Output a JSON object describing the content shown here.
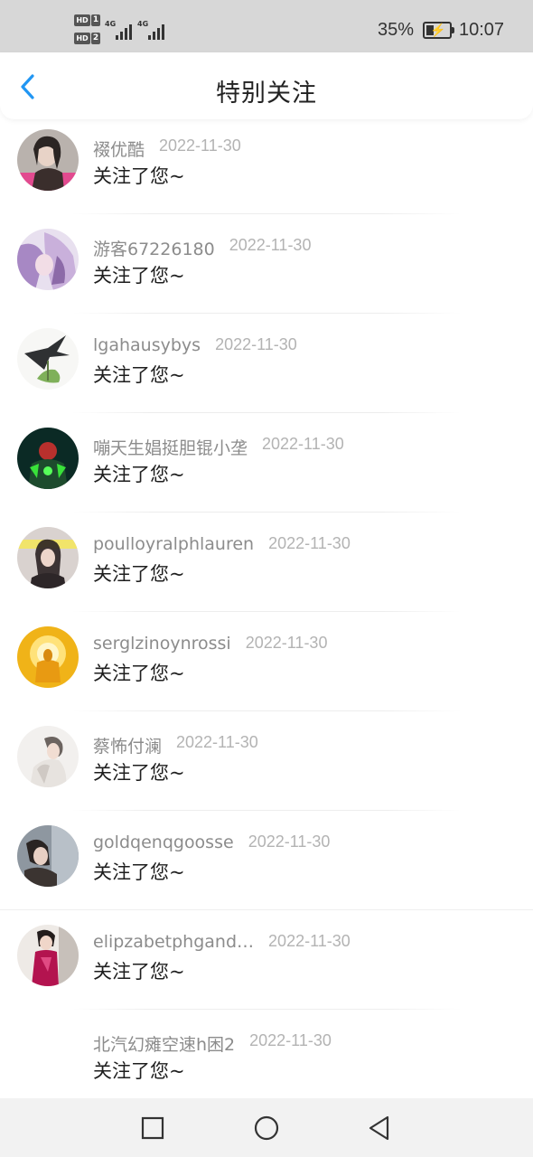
{
  "status_bar": {
    "sim1_badge": "HD",
    "sim1_num": "1",
    "sim2_badge": "HD",
    "sim2_num": "2",
    "network1": "4G",
    "network2": "4G",
    "battery_percent": "35%",
    "battery_level": 0.35,
    "time": "10:07"
  },
  "header": {
    "title": "特别关注",
    "back_icon": "chevron-left-icon",
    "accent_color": "#2196f3"
  },
  "followers": [
    {
      "name": "裰优酷",
      "date": "2022-11-30",
      "message": "关注了您~"
    },
    {
      "name": "游客67226180",
      "date": "2022-11-30",
      "message": "关注了您~"
    },
    {
      "name": "lgahausybys",
      "date": "2022-11-30",
      "message": "关注了您~"
    },
    {
      "name": "嘣天生娼挺胆锟小垄",
      "date": "2022-11-30",
      "message": "关注了您~"
    },
    {
      "name": "poulloyralphlauren",
      "date": "2022-11-30",
      "message": "关注了您~"
    },
    {
      "name": "serglzinoynrossi",
      "date": "2022-11-30",
      "message": "关注了您~"
    },
    {
      "name": "蔡怖付澜",
      "date": "2022-11-30",
      "message": "关注了您~"
    },
    {
      "name": "goldqenqgoosse",
      "date": "2022-11-30",
      "message": "关注了您~"
    },
    {
      "name": "elipzabetphgand…",
      "date": "2022-11-30",
      "message": "关注了您~"
    },
    {
      "name": "北汽幻瘫空速h困2",
      "date": "2022-11-30",
      "message": "关注了您~"
    }
  ],
  "nav_bar": {
    "recents_icon": "square-icon",
    "home_icon": "circle-icon",
    "back_icon": "triangle-back-icon"
  }
}
